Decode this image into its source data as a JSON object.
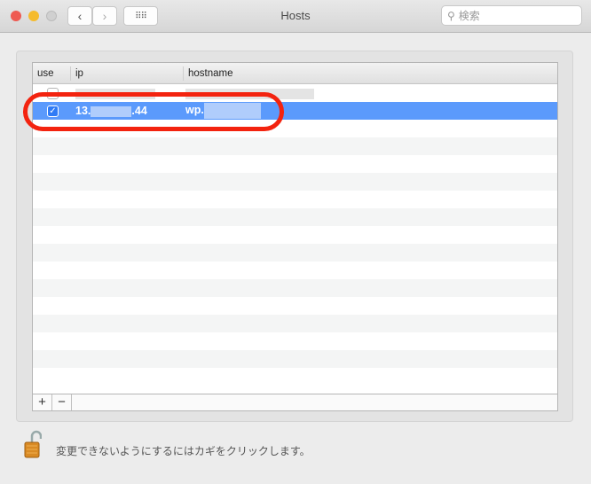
{
  "window": {
    "title": "Hosts",
    "search_placeholder": "検索"
  },
  "table": {
    "headers": [
      "use",
      "ip",
      "hostname"
    ],
    "rows": [
      {
        "use": false,
        "ip": "",
        "hostname": ""
      },
      {
        "use": true,
        "ip": "13.",
        "ip_suffix": ".44",
        "hostname": "wp.",
        "selected": true
      }
    ],
    "empty_rows": 15
  },
  "footer": {
    "add": "+",
    "remove": "−"
  },
  "lock_text": "変更できないようにするにはカギをクリックします。",
  "colors": {
    "selection": "#5b9afc",
    "highlight_ring": "#f3230f"
  }
}
